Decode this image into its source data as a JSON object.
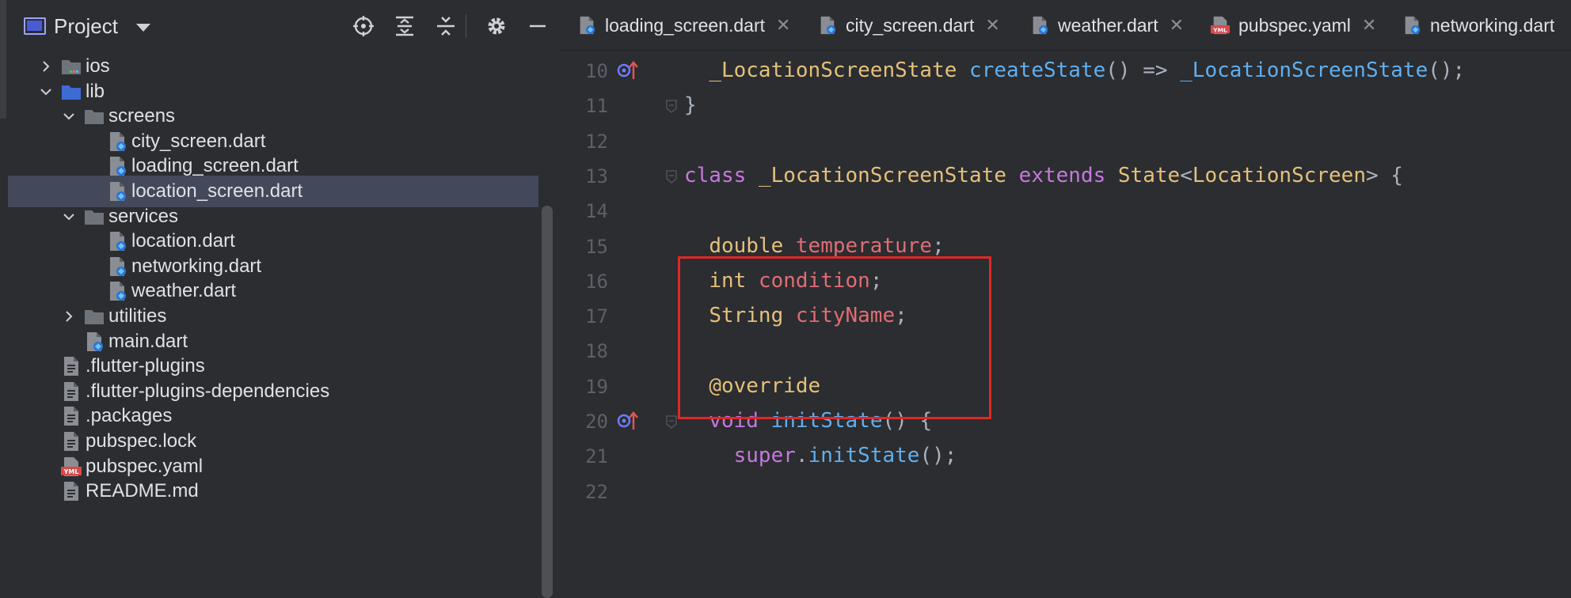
{
  "project_panel": {
    "title": "Project",
    "toolbar": {
      "locate_icon": "crosshair-icon",
      "expand_icon": "expand-all-icon",
      "collapse_icon": "collapse-all-icon",
      "settings_icon": "gear-icon",
      "hide_icon": "minus-icon"
    },
    "tree": [
      {
        "label": "ios",
        "kind": "folder-ios",
        "depth": 1,
        "expanded": false
      },
      {
        "label": "lib",
        "kind": "folder-blue",
        "depth": 1,
        "expanded": true
      },
      {
        "label": "screens",
        "kind": "folder",
        "depth": 2,
        "expanded": true
      },
      {
        "label": "city_screen.dart",
        "kind": "dart-file",
        "depth": 3
      },
      {
        "label": "loading_screen.dart",
        "kind": "dart-file",
        "depth": 3
      },
      {
        "label": "location_screen.dart",
        "kind": "dart-file",
        "depth": 3,
        "selected": true
      },
      {
        "label": "services",
        "kind": "folder",
        "depth": 2,
        "expanded": true
      },
      {
        "label": "location.dart",
        "kind": "dart-file",
        "depth": 3
      },
      {
        "label": "networking.dart",
        "kind": "dart-file",
        "depth": 3
      },
      {
        "label": "weather.dart",
        "kind": "dart-file",
        "depth": 3
      },
      {
        "label": "utilities",
        "kind": "folder",
        "depth": 2,
        "expanded": false
      },
      {
        "label": "main.dart",
        "kind": "dart-file",
        "depth": 2
      },
      {
        "label": ".flutter-plugins",
        "kind": "text-file",
        "depth": 1
      },
      {
        "label": ".flutter-plugins-dependencies",
        "kind": "text-file",
        "depth": 1
      },
      {
        "label": ".packages",
        "kind": "text-file",
        "depth": 1
      },
      {
        "label": "pubspec.lock",
        "kind": "text-file",
        "depth": 1
      },
      {
        "label": "pubspec.yaml",
        "kind": "yaml-file",
        "depth": 1
      },
      {
        "label": "README.md",
        "kind": "text-file",
        "depth": 1
      }
    ]
  },
  "tabs": [
    {
      "label": "loading_screen.dart",
      "icon": "dart-file-icon"
    },
    {
      "label": "city_screen.dart",
      "icon": "dart-file-icon"
    },
    {
      "label": "weather.dart",
      "icon": "dart-file-icon"
    },
    {
      "label": "pubspec.yaml",
      "icon": "yaml-file-icon"
    },
    {
      "label": "networking.dart",
      "icon": "dart-file-icon"
    }
  ],
  "editor": {
    "lines": [
      {
        "no": "10",
        "marker": "override",
        "tokens": [
          [
            "  ",
            "plain"
          ],
          [
            "_LocationScreenState",
            "type"
          ],
          [
            " ",
            "plain"
          ],
          [
            "createState",
            "method"
          ],
          [
            "() => ",
            "punct"
          ],
          [
            "_LocationScreenState",
            "method"
          ],
          [
            "();",
            "punct"
          ]
        ]
      },
      {
        "no": "11",
        "fold": true,
        "tokens": [
          [
            "}",
            "punct"
          ]
        ]
      },
      {
        "no": "12",
        "tokens": []
      },
      {
        "no": "13",
        "fold": true,
        "tokens": [
          [
            "class",
            "kw"
          ],
          [
            " ",
            "plain"
          ],
          [
            "_LocationScreenState",
            "type"
          ],
          [
            " ",
            "plain"
          ],
          [
            "extends",
            "kw"
          ],
          [
            " ",
            "plain"
          ],
          [
            "State",
            "type"
          ],
          [
            "<",
            "punct"
          ],
          [
            "LocationScreen",
            "type"
          ],
          [
            "> {",
            "punct"
          ]
        ]
      },
      {
        "no": "14",
        "tokens": []
      },
      {
        "no": "15",
        "tokens": [
          [
            "  ",
            "plain"
          ],
          [
            "double",
            "type"
          ],
          [
            " ",
            "plain"
          ],
          [
            "temperature",
            "field"
          ],
          [
            ";",
            "punct"
          ]
        ]
      },
      {
        "no": "16",
        "tokens": [
          [
            "  ",
            "plain"
          ],
          [
            "int",
            "type"
          ],
          [
            " ",
            "plain"
          ],
          [
            "condition",
            "field"
          ],
          [
            ";",
            "punct"
          ]
        ]
      },
      {
        "no": "17",
        "tokens": [
          [
            "  ",
            "plain"
          ],
          [
            "String",
            "type"
          ],
          [
            " ",
            "plain"
          ],
          [
            "cityName",
            "field"
          ],
          [
            ";",
            "punct"
          ]
        ]
      },
      {
        "no": "18",
        "tokens": []
      },
      {
        "no": "19",
        "tokens": [
          [
            "  ",
            "plain"
          ],
          [
            "@",
            "type"
          ],
          [
            "override",
            "type"
          ]
        ]
      },
      {
        "no": "20",
        "marker": "override",
        "fold": true,
        "tokens": [
          [
            "  ",
            "plain"
          ],
          [
            "void",
            "kw"
          ],
          [
            " ",
            "plain"
          ],
          [
            "initState",
            "method"
          ],
          [
            "() {",
            "punct"
          ]
        ]
      },
      {
        "no": "21",
        "tokens": [
          [
            "    ",
            "plain"
          ],
          [
            "super",
            "kw"
          ],
          [
            ".",
            "punct"
          ],
          [
            "initState",
            "method"
          ],
          [
            "();",
            "punct"
          ]
        ]
      },
      {
        "no": "22",
        "tokens": []
      }
    ],
    "annotation_color": "#e02828"
  },
  "colors": {
    "type": "#e5c07b",
    "keyword": "#c678dd",
    "method": "#61afef",
    "field": "#e06c75",
    "selection": "#43495a"
  }
}
